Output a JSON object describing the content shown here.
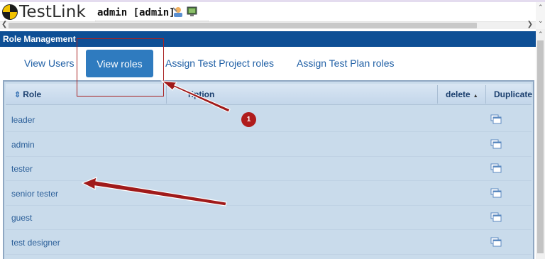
{
  "app": {
    "logo_text": "TestLink",
    "user_label": "admin [admin]"
  },
  "page": {
    "header_title": "Role Management"
  },
  "tabs": [
    {
      "label": "View Users",
      "active": false
    },
    {
      "label": "View roles",
      "active": true
    },
    {
      "label": "Assign Test Project roles",
      "active": false
    },
    {
      "label": "Assign Test Plan roles",
      "active": false
    }
  ],
  "table": {
    "columns": {
      "role": "Role",
      "description": "Description",
      "delete": "delete",
      "duplicate": "Duplicate"
    },
    "visible_description_header": "ription",
    "rows": [
      {
        "role": "leader"
      },
      {
        "role": "admin"
      },
      {
        "role": "tester"
      },
      {
        "role": "senior tester"
      },
      {
        "role": "guest"
      },
      {
        "role": "test designer"
      }
    ]
  },
  "annotation": {
    "badge": "1",
    "color": "#b01c1c"
  },
  "colors": {
    "header_bar": "#0e4f95",
    "active_tab": "#2f7bbf",
    "table_bg": "#c9dbeb",
    "link": "#2b5f99"
  },
  "icons": {
    "logo": "testlink-logo-icon",
    "user": "user-settings-icon",
    "monitor": "monitor-icon",
    "duplicate": "duplicate-icon",
    "sort": "sort-icon"
  }
}
